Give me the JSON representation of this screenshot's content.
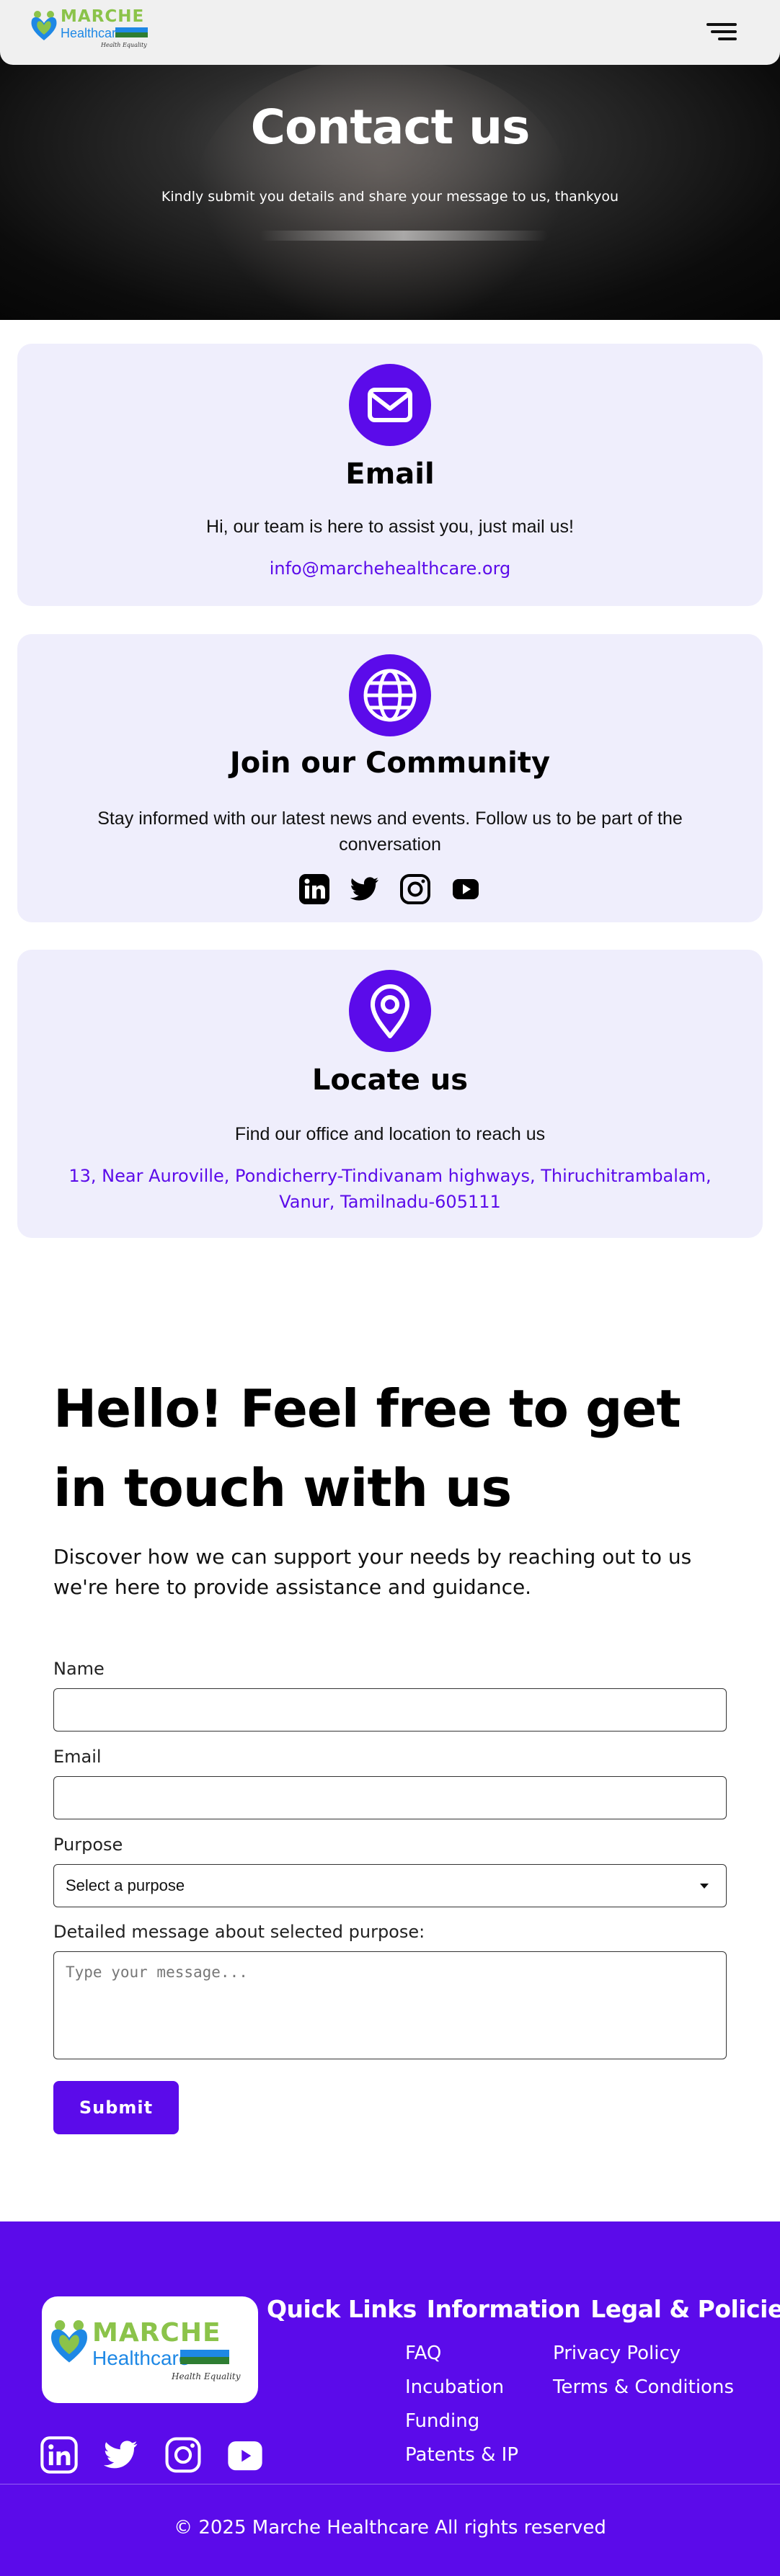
{
  "header": {
    "logo": {
      "name": "MARCHE",
      "sub": "Healthcare",
      "tagline": "Health Equality"
    }
  },
  "hero": {
    "title": "Contact us",
    "subtitle": "Kindly submit you details and share your message to us, thankyou"
  },
  "cards": {
    "email": {
      "title": "Email",
      "text": "Hi, our team is here to assist you, just mail us!",
      "link": "info@marchehealthcare.org"
    },
    "community": {
      "title": "Join our Community",
      "text": "Stay informed with our latest news and events. Follow us to be part of the conversation"
    },
    "locate": {
      "title": "Locate us",
      "text": "Find our office and location to reach us",
      "address": "13, Near Auroville, Pondicherry-Tindivanam highways, Thiruchitrambalam, Vanur, Tamilnadu-605111"
    }
  },
  "form": {
    "title": "Hello! Feel free to get in touch with us",
    "description": "Discover how we can support your needs by reaching out to us we're here to provide assistance and guidance.",
    "name_label": "Name",
    "name_value": "",
    "email_label": "Email",
    "email_value": "",
    "purpose_label": "Purpose",
    "purpose_value": "Select a purpose",
    "message_label": "Detailed message about selected purpose:",
    "message_placeholder": "Type your message...",
    "submit_label": "Submit"
  },
  "footer": {
    "logo": {
      "name": "MARCHE",
      "sub": "Healthcare",
      "tagline": "Health Equality"
    },
    "headings": [
      "Quick Links",
      "Information",
      "Legal & Policies"
    ],
    "information_links": [
      "FAQ",
      "Incubation",
      "Funding",
      "Patents & IP"
    ],
    "legal_links": [
      "Privacy Policy",
      "Terms & Conditions"
    ],
    "copyright": "© 2025 Marche Healthcare All rights reserved"
  },
  "socials": [
    "linkedin-icon",
    "twitter-icon",
    "instagram-icon",
    "youtube-icon"
  ],
  "colors": {
    "accent": "#5b0bea",
    "card_bg": "#efeefc",
    "brand_green": "#8bc34a",
    "brand_blue": "#1e88e5"
  }
}
